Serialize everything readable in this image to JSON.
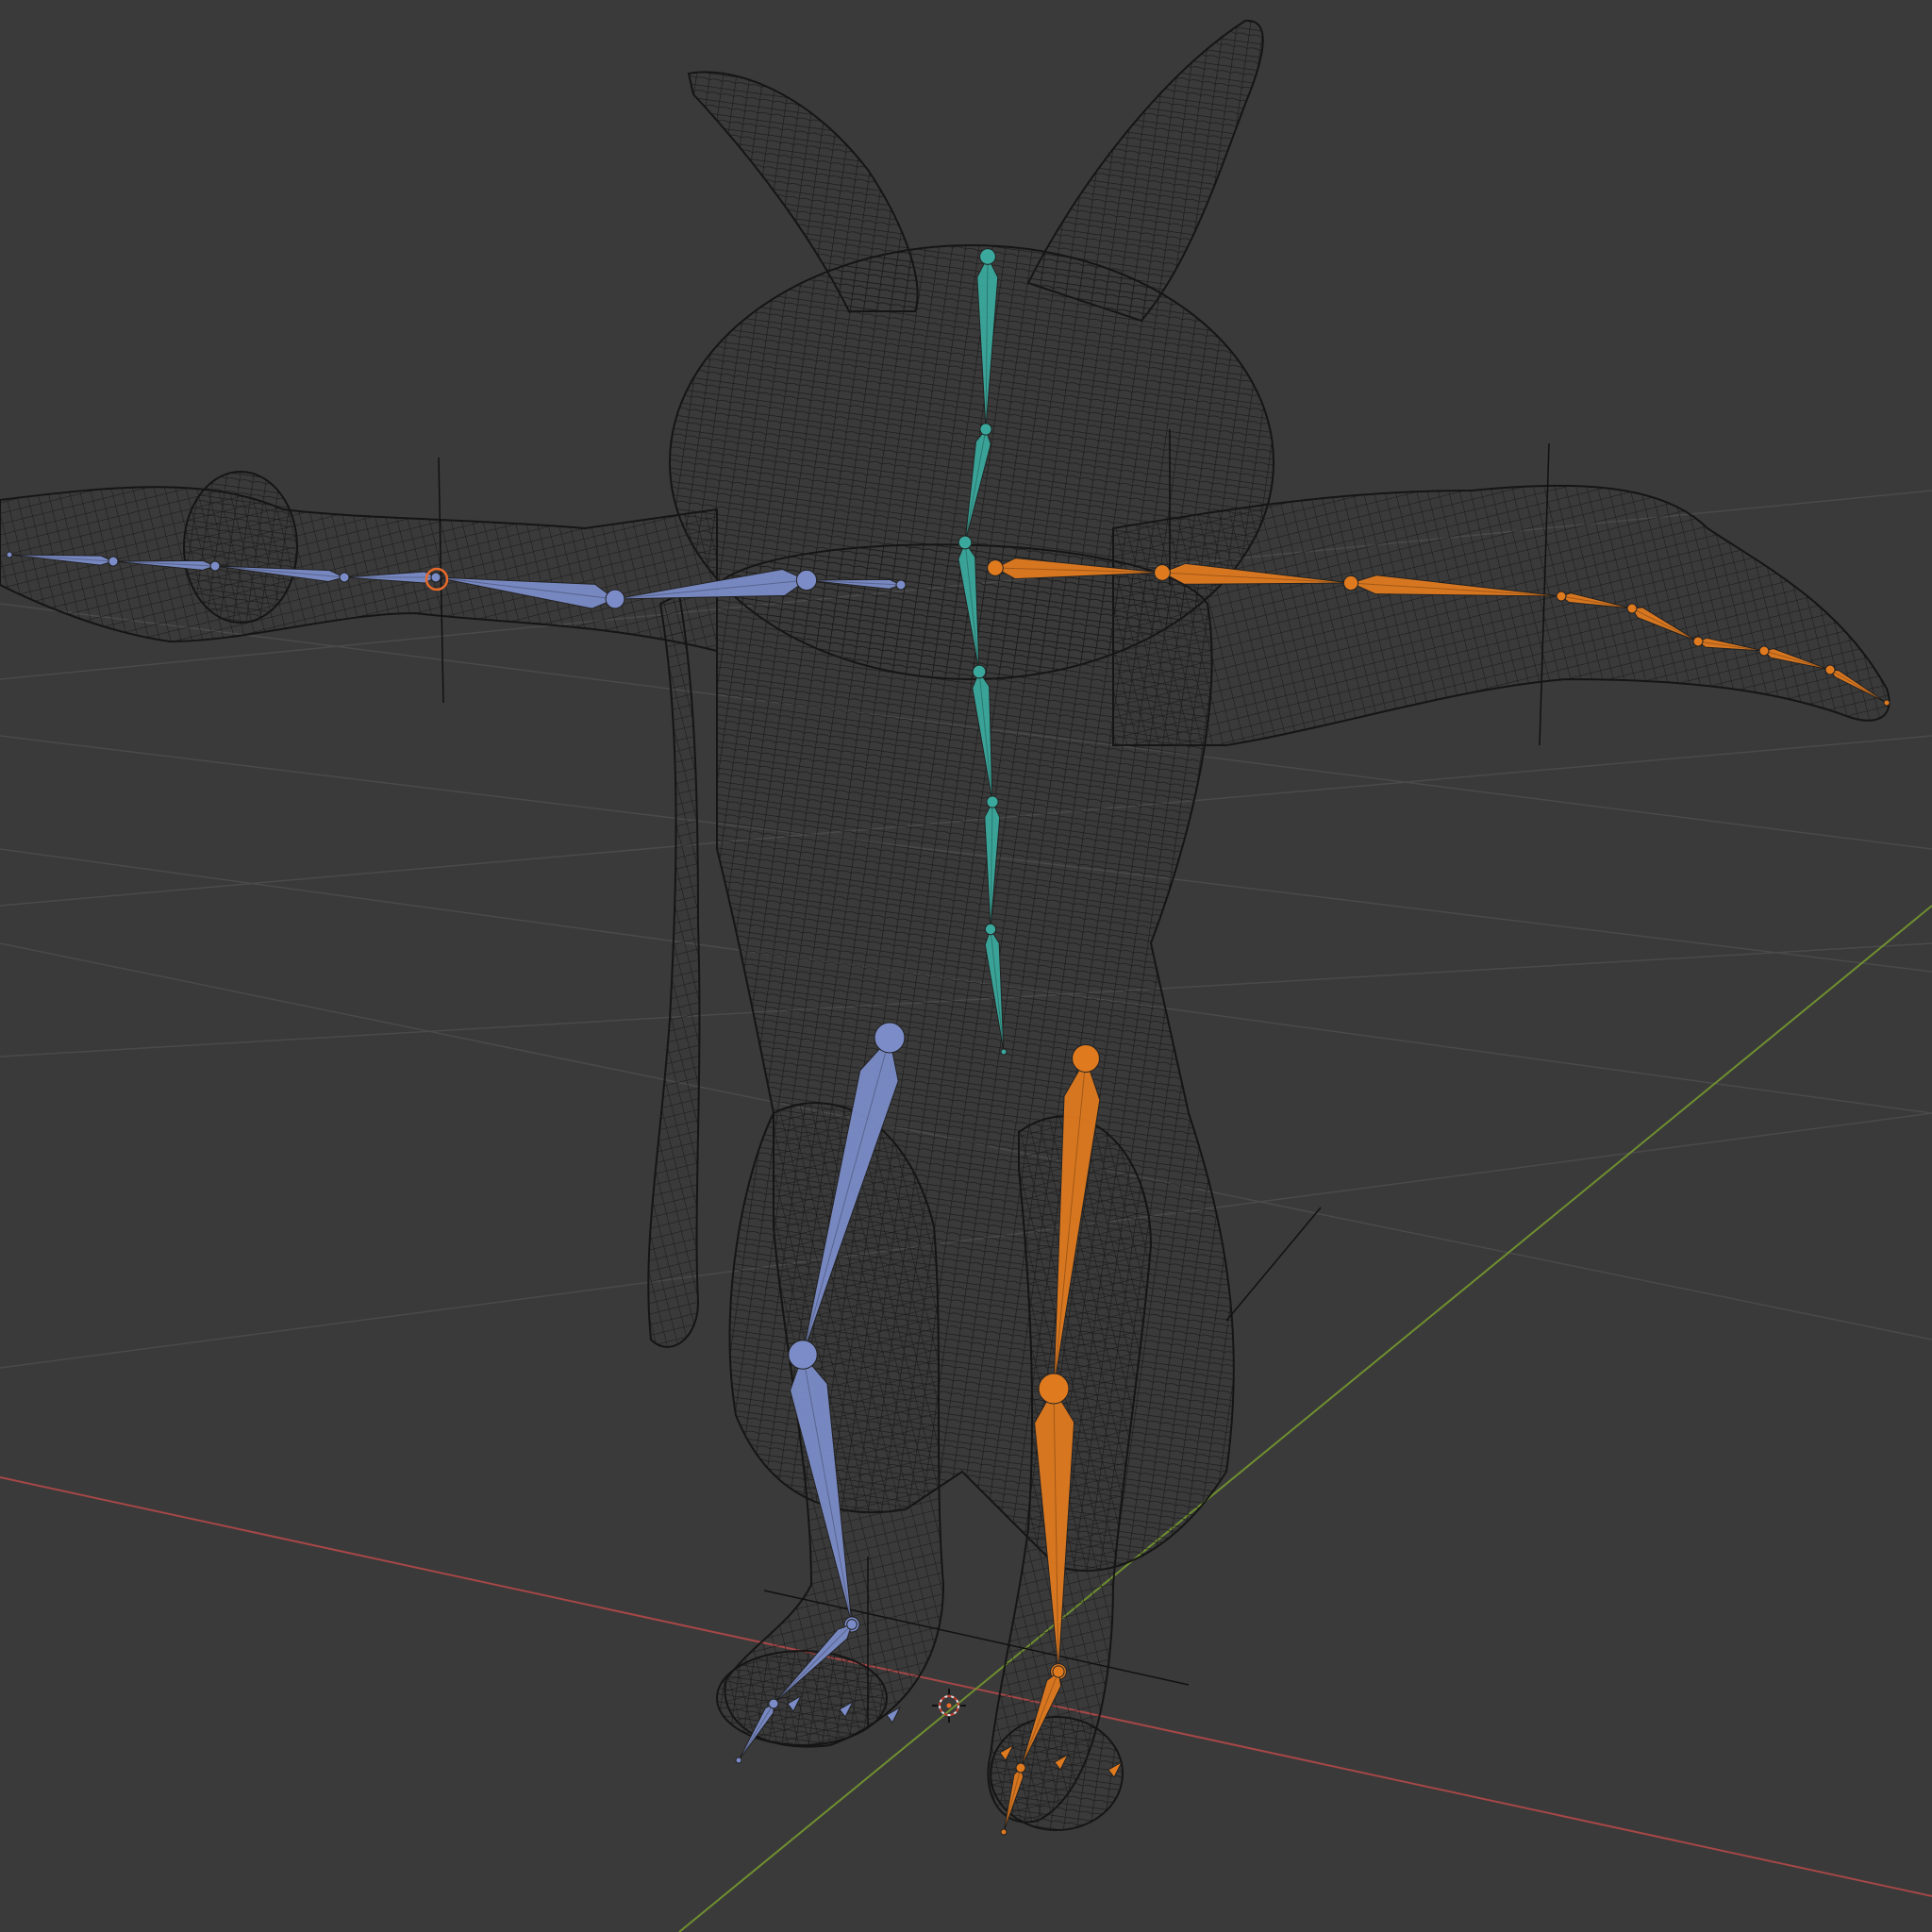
{
  "viewport": {
    "background": "#3a3a3a",
    "grid_color": "#4a4a4a",
    "x_axis_color": "#a64747",
    "y_axis_color": "#6f8f2f",
    "mesh_color": "#141414",
    "object_origin_icon": "3d-cursor-icon"
  },
  "armature": {
    "bone_colors": {
      "spine": "#3aa89c",
      "left_side": "#7b8cc8",
      "right_side": "#e07a1f",
      "selected_outline": "#e86a2a"
    },
    "display_mode": "octahedral",
    "bone_groups": [
      "spine",
      "left_arm",
      "right_arm",
      "left_leg",
      "right_leg"
    ]
  },
  "mesh": {
    "display": "wireframe",
    "description_icon": "creature-mesh-icon"
  }
}
